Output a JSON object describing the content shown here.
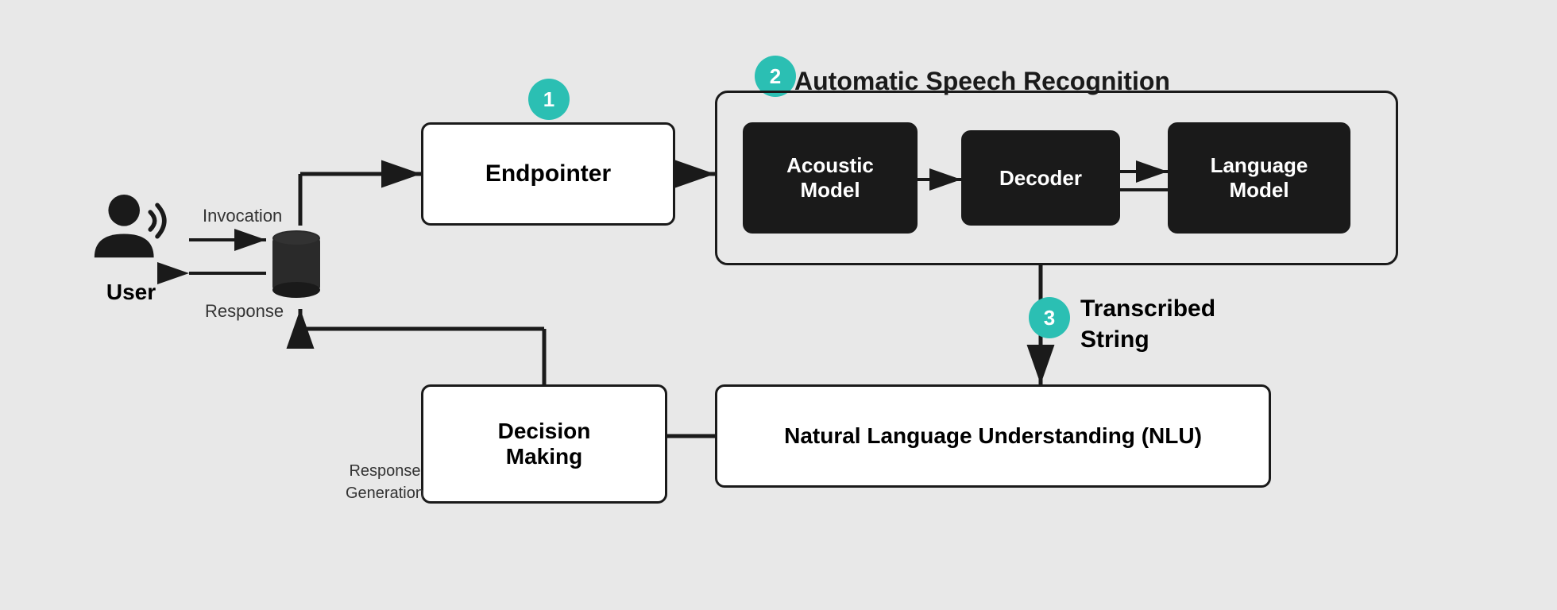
{
  "diagram": {
    "background": "#e8e8e8",
    "accent_color": "#2bbfb3",
    "user_label": "User",
    "invocation_label": "Invocation",
    "response_label": "Response",
    "badge_1": "1",
    "badge_2": "2",
    "badge_3": "3",
    "asr_title": "Automatic Speech Recognition",
    "endpointer_label": "Endpointer",
    "acoustic_model_label": "Acoustic\nModel",
    "decoder_label": "Decoder",
    "language_model_label": "Language\nModel",
    "nlu_label": "Natural Language Understanding (NLU)",
    "decision_making_label": "Decision\nMaking",
    "transcribed_label": "Transcribed\nString",
    "response_gen_label": "Response\nGeneration"
  }
}
